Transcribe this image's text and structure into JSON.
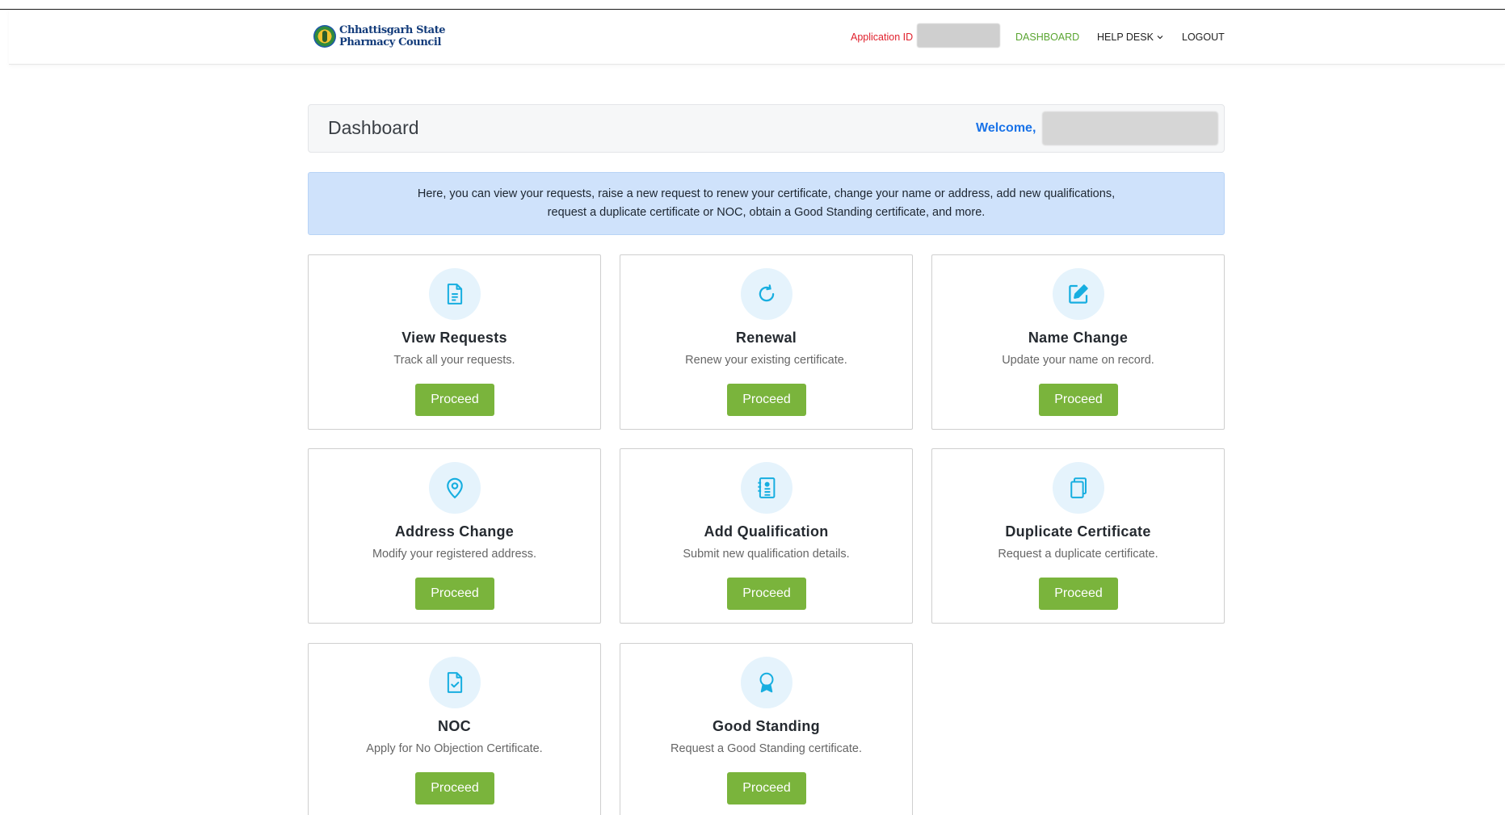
{
  "header": {
    "logo_line1": "Chhattisgarh State",
    "logo_line2": "Pharmacy Council",
    "app_id_label": "Application ID",
    "nav_dashboard": "DASHBOARD",
    "nav_help": "HELP DESK",
    "nav_logout": "LOGOUT"
  },
  "dashboard": {
    "title": "Dashboard",
    "welcome": "Welcome,"
  },
  "info": {
    "line1": "Here, you can view your requests, raise a new request to renew your certificate, change your name or address, add new qualifications,",
    "line2": "request a duplicate certificate or NOC, obtain a Good Standing certificate, and more."
  },
  "cards": [
    {
      "icon": "document-icon",
      "title": "View Requests",
      "desc": "Track all your requests.",
      "button": "Proceed"
    },
    {
      "icon": "refresh-icon",
      "title": "Renewal",
      "desc": "Renew your existing certificate.",
      "button": "Proceed"
    },
    {
      "icon": "edit-icon",
      "title": "Name Change",
      "desc": "Update your name on record.",
      "button": "Proceed"
    },
    {
      "icon": "location-pin-icon",
      "title": "Address Change",
      "desc": "Modify your registered address.",
      "button": "Proceed"
    },
    {
      "icon": "contact-book-icon",
      "title": "Add Qualification",
      "desc": "Submit new qualification details.",
      "button": "Proceed"
    },
    {
      "icon": "copy-icon",
      "title": "Duplicate Certificate",
      "desc": "Request a duplicate certificate.",
      "button": "Proceed"
    },
    {
      "icon": "file-check-icon",
      "title": "NOC",
      "desc": "Apply for No Objection Certificate.",
      "button": "Proceed"
    },
    {
      "icon": "award-icon",
      "title": "Good Standing",
      "desc": "Request a Good Standing certificate.",
      "button": "Proceed"
    }
  ],
  "colors": {
    "accent_green": "#7ab43c",
    "nav_active": "#5aa531",
    "app_id_red": "#e0202c",
    "welcome_blue": "#1a73e8",
    "info_bg": "#cfe2fb",
    "icon_cyan": "#17aee0"
  }
}
